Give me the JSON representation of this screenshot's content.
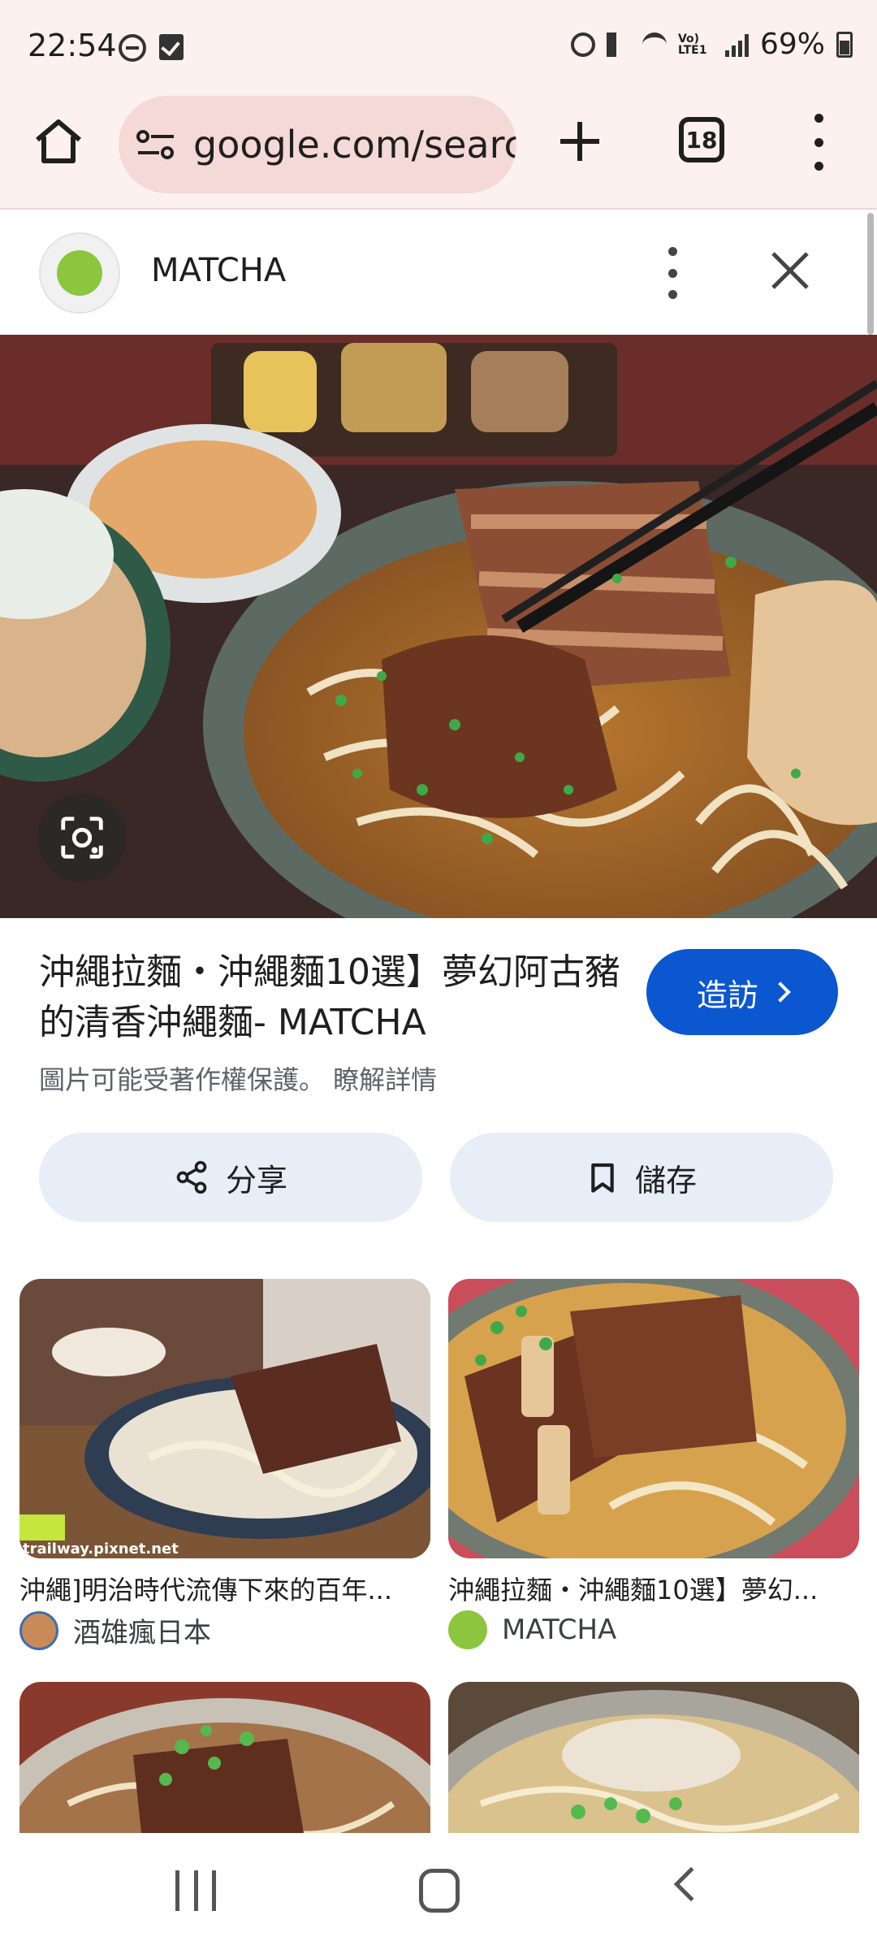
{
  "status_bar": {
    "time": "22:54",
    "battery": "69%",
    "network": "Vo) LTE1"
  },
  "browser": {
    "url": "google.com/searc",
    "tab_count": "18"
  },
  "source": {
    "name": "MATCHA",
    "favicon_color": "#8cc63f"
  },
  "result": {
    "title": "沖繩拉麵・沖繩麵10選】夢幻阿古豬的清香沖繩麵- MATCHA",
    "visit_label": "造訪",
    "copyright_notice": "圖片可能受著作權保護。 瞭解詳情",
    "share_label": "分享",
    "save_label": "儲存"
  },
  "related": [
    {
      "title": "沖繩]明治時代流傳下來的百年...",
      "source": "酒雄瘋日本",
      "watermark": "trailway.pixnet.net",
      "source_color": "#c98a5a"
    },
    {
      "title": "沖繩拉麵・沖繩麵10選】夢幻...",
      "source": "MATCHA",
      "source_color": "#8cc63f"
    },
    {
      "title": "",
      "source": ""
    },
    {
      "title": "",
      "source": ""
    }
  ],
  "colors": {
    "accent": "#0b57d0",
    "chrome_bg": "#fcf1ef",
    "omnibox_bg": "#f4d9d6",
    "pill_bg": "#e8eef8"
  }
}
